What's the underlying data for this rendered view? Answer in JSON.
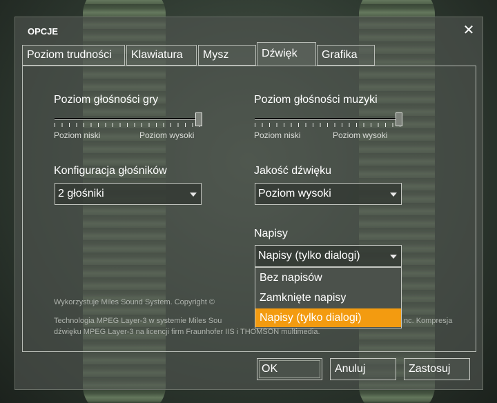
{
  "window": {
    "title": "OPCJE"
  },
  "tabs": [
    {
      "label": "Poziom trudności"
    },
    {
      "label": "Klawiatura"
    },
    {
      "label": "Mysz"
    },
    {
      "label": "Dźwięk",
      "active": true
    },
    {
      "label": "Grafika"
    }
  ],
  "game_volume": {
    "label": "Poziom głośności gry",
    "min_label": "Poziom niski",
    "max_label": "Poziom wysoki",
    "value": 1.0
  },
  "music_volume": {
    "label": "Poziom głośności muzyki",
    "min_label": "Poziom niski",
    "max_label": "Poziom wysoki",
    "value": 1.0
  },
  "speakers": {
    "label": "Konfiguracja głośników",
    "value": "2 głośniki"
  },
  "quality": {
    "label": "Jakość dźwięku",
    "value": "Poziom wysoki"
  },
  "subtitles": {
    "label": "Napisy",
    "value": "Napisy (tylko dialogi)",
    "options": [
      "Bez napisów",
      "Zamknięte napisy",
      "Napisy (tylko dialogi)"
    ]
  },
  "notes": {
    "miles": "Wykorzystuje Miles Sound System. Copyright ©",
    "mpeg1": "Technologia MPEG Layer-3 w systemie Miles Sou",
    "mpeg1_tail": "nc. Kompresja",
    "mpeg2": "dźwięku MPEG Layer-3 na licencji firm Fraunhofer IIS i THOMSON multimedia."
  },
  "buttons": {
    "ok": "OK",
    "cancel": "Anuluj",
    "apply": "Zastosuj"
  },
  "colors": {
    "highlight": "#f39b10"
  }
}
